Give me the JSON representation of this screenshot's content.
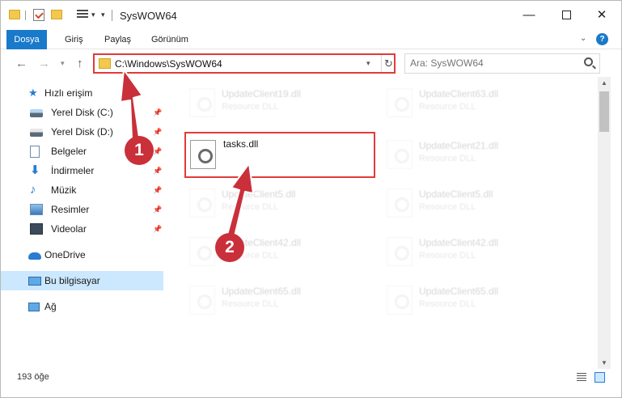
{
  "window": {
    "title": "SysWOW64"
  },
  "ribbon": {
    "tabs": [
      "Dosya",
      "Giriş",
      "Paylaş",
      "Görünüm"
    ]
  },
  "address": {
    "path": "C:\\Windows\\SysWOW64"
  },
  "search": {
    "placeholder": "Ara: SysWOW64"
  },
  "sidebar": {
    "items": [
      {
        "label": "Hızlı erişim",
        "icon": "star-icon"
      },
      {
        "label": "Yerel Disk (C:)",
        "icon": "drive-icon"
      },
      {
        "label": "Yerel Disk (D:)",
        "icon": "drive-icon"
      },
      {
        "label": "Belgeler",
        "icon": "documents-icon"
      },
      {
        "label": "İndirmeler",
        "icon": "download-icon"
      },
      {
        "label": "Müzik",
        "icon": "music-icon"
      },
      {
        "label": "Resimler",
        "icon": "pictures-icon"
      },
      {
        "label": "Videolar",
        "icon": "videos-icon"
      },
      {
        "label": "OneDrive",
        "icon": "cloud-icon"
      },
      {
        "label": "Bu bilgisayar",
        "icon": "computer-icon"
      },
      {
        "label": "Ağ",
        "icon": "network-icon"
      }
    ]
  },
  "files": {
    "left": [
      {
        "name": "UpdateClient19.dll",
        "type": "Resource DLL"
      },
      {
        "name": "tasks.dll",
        "type": ""
      },
      {
        "name": "UpdateClient5.dll",
        "type": "Resource DLL"
      },
      {
        "name": "UpdateClient42.dll",
        "type": "Resource DLL"
      },
      {
        "name": "UpdateClient65.dll",
        "type": "Resource DLL"
      }
    ],
    "right": [
      {
        "name": "UpdateClient63.dll",
        "type": "Resource DLL"
      },
      {
        "name": "UpdateClient21.dll",
        "type": "Resource DLL"
      },
      {
        "name": "UpdateClient5.dll",
        "type": "Resource DLL"
      },
      {
        "name": "UpdateClient42.dll",
        "type": "Resource DLL"
      },
      {
        "name": "UpdateClient65.dll",
        "type": "Resource DLL"
      }
    ]
  },
  "status": {
    "count": "193 öğe"
  },
  "annotations": {
    "marker1": "1",
    "marker2": "2",
    "color": "#c9303a"
  },
  "colors": {
    "accent": "#1979ca",
    "highlight_border": "#e23a3a",
    "selected_nav": "#cce8ff"
  }
}
